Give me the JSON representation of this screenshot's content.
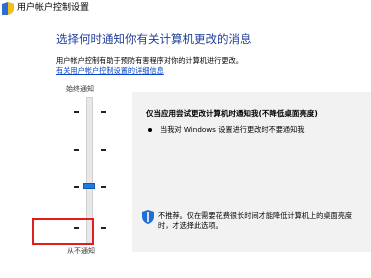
{
  "window": {
    "title": "用户帐户控制设置"
  },
  "main": {
    "heading": "选择何时通知你有关计算机更改的消息",
    "description": "用户帐户控制有助于预防有害程序对你的计算机进行更改。",
    "link_text": "有关用户帐户控制设置的详细信息"
  },
  "slider": {
    "top_label": "始终通知",
    "bottom_label": "从不通知",
    "levels": 4,
    "selected_level_from_bottom": 2
  },
  "info": {
    "title": "仅当应用尝试更改计算机时通知我(不降低桌面亮度)",
    "items": [
      "当我对 Windows 设置进行更改时不要通知我"
    ],
    "warning": "不推荐。仅在需要花费很长时间才能降低计算机上的桌面亮度时，才选择此选项。"
  },
  "colors": {
    "heading": "#1e3d9b",
    "link": "#0645c6",
    "slider_thumb": "#1f7be0",
    "info_background": "#f2f2f2",
    "highlight_border": "#e01e1e"
  },
  "icons": {
    "title": "uac-shield-icon",
    "warning": "uac-shield-icon"
  }
}
